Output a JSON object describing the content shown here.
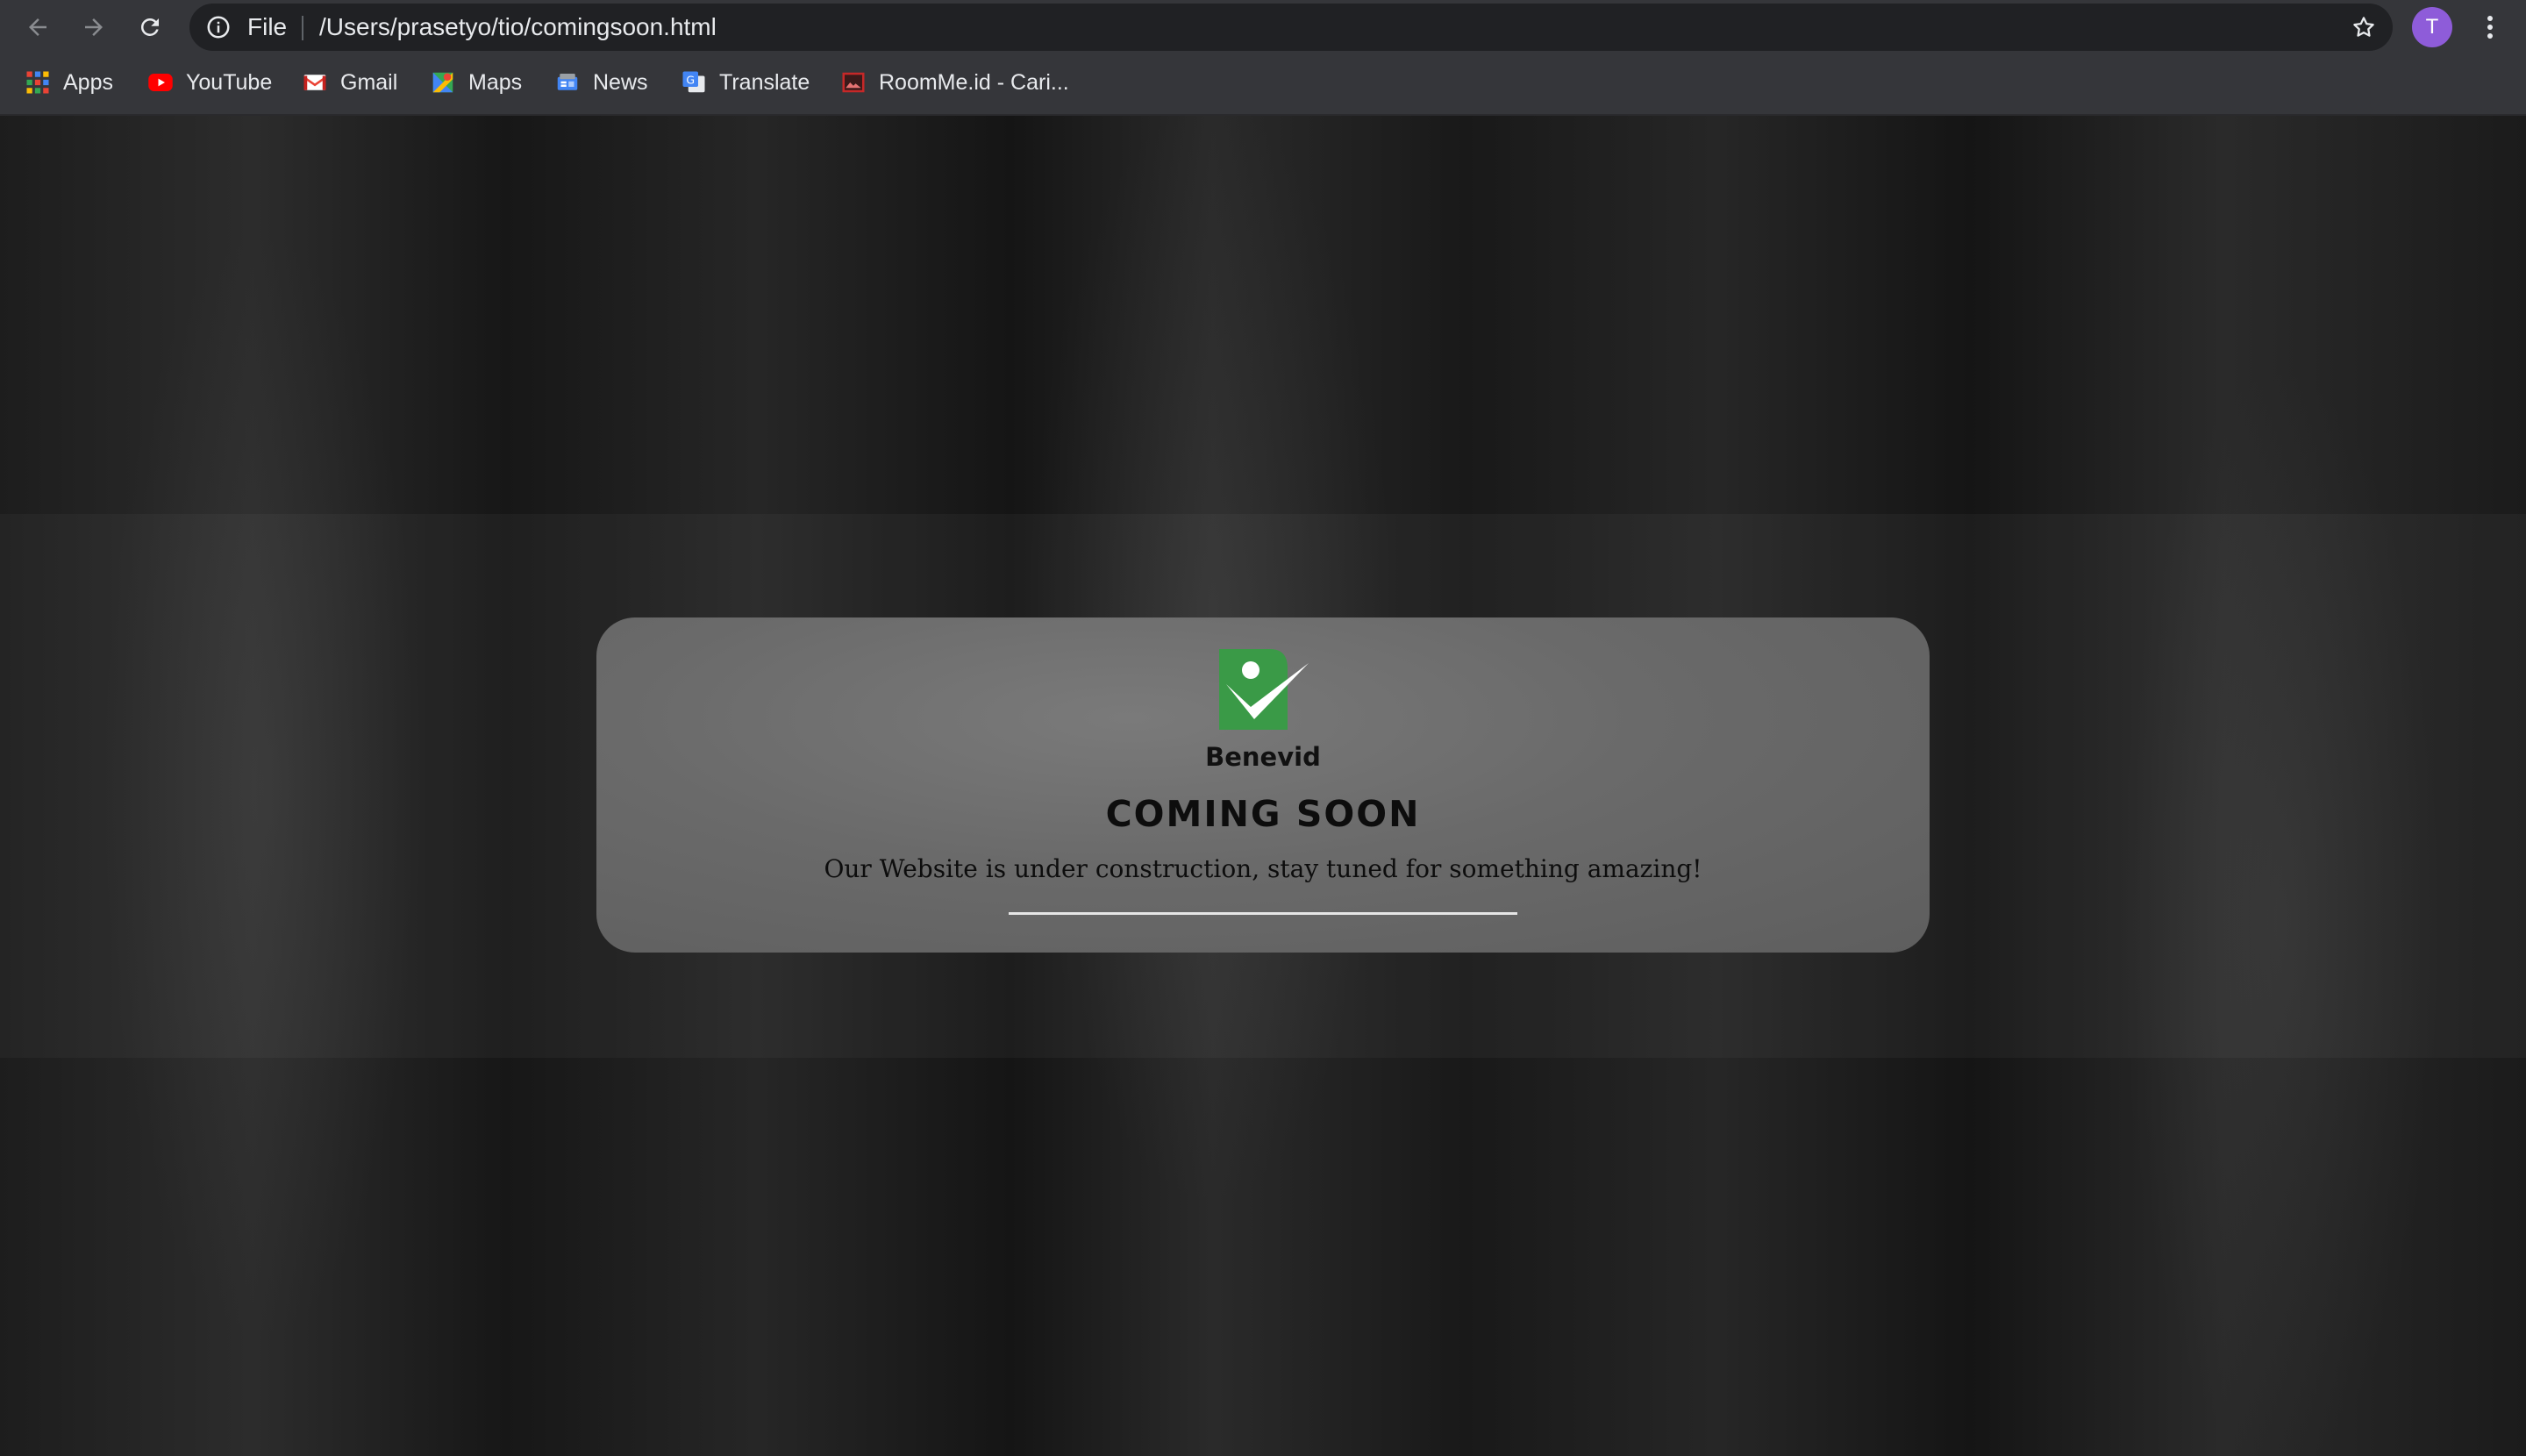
{
  "toolbar": {
    "back_icon": "arrow-left-icon",
    "forward_icon": "arrow-right-icon",
    "reload_icon": "reload-icon",
    "address": {
      "scheme_label": "File",
      "url": "/Users/prasetyo/tio/comingsoon.html"
    },
    "profile_initial": "T",
    "profile_color": "#8e5cd9"
  },
  "bookmarks": {
    "items": [
      {
        "label": "Apps",
        "icon": "apps-grid-icon"
      },
      {
        "label": "YouTube",
        "icon": "youtube-icon"
      },
      {
        "label": "Gmail",
        "icon": "gmail-icon"
      },
      {
        "label": "Maps",
        "icon": "maps-icon"
      },
      {
        "label": "News",
        "icon": "news-icon"
      },
      {
        "label": "Translate",
        "icon": "translate-icon"
      },
      {
        "label": "RoomMe.id - Cari...",
        "icon": "roomme-icon"
      }
    ]
  },
  "page": {
    "brand_name": "Benevid",
    "heading": "COMING SOON",
    "message": "Our Website is under construction, stay tuned for something amazing!",
    "logo_color": "#3a9a47"
  }
}
